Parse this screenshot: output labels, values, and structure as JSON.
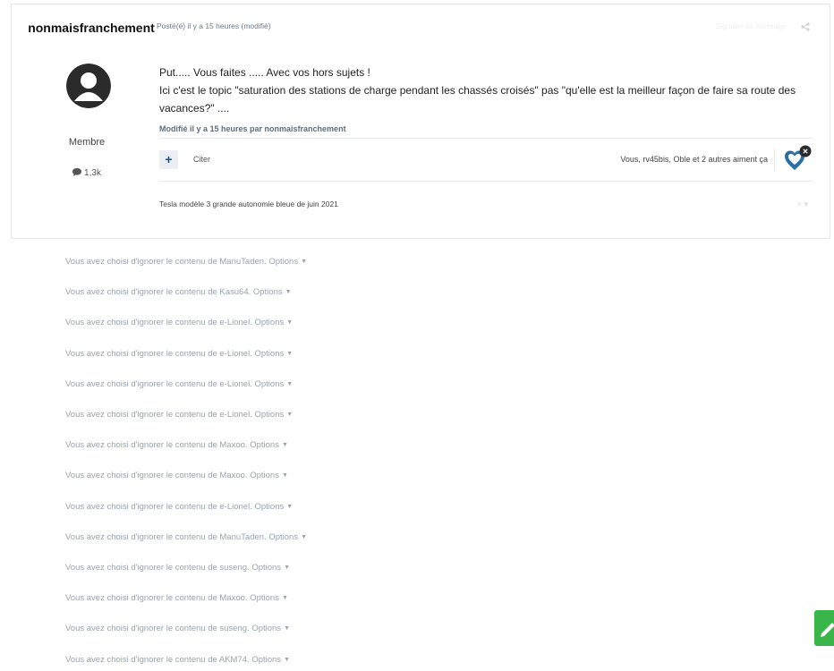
{
  "post": {
    "author_name": "nonmaisfranchement",
    "author_role": "Membre",
    "post_count": "1,3k",
    "meta": "Posté(é) il y a 15 heures (modifié)",
    "report_label": "Signaler ce message",
    "content": [
      "Put..... Vous faites ..... Avec vos hors sujets !",
      "Ici c'est le topic \"saturation des stations de charge pendant les chassés croisés\" pas \"qu'elle est la meilleur façon de faire sa route des vacances?\" ...."
    ],
    "edited_note": "Modifié il y a 15 heures par nonmaisfranchement",
    "quote_label": "Citer",
    "plus_label": "+",
    "likers": "Vous, rv45bis, Oble et 2 autres aiment ça",
    "signature": "Tesla modèle 3 grande autonomie bleue de juin 2021",
    "signature_ctrl": "× ▾"
  },
  "ignored": [
    {
      "text": "Vous avez choisi d'ignorer le contenu de ManuTaden.",
      "options": "Options"
    },
    {
      "text": "Vous avez choisi d'ignorer le contenu de Kasu64.",
      "options": "Options"
    },
    {
      "text": "Vous avez choisi d'ignorer le contenu de e-Lionel.",
      "options": "Options"
    },
    {
      "text": "Vous avez choisi d'ignorer le contenu de e-Lionel.",
      "options": "Options"
    },
    {
      "text": "Vous avez choisi d'ignorer le contenu de e-Lionel.",
      "options": "Options"
    },
    {
      "text": "Vous avez choisi d'ignorer le contenu de e-Lionel.",
      "options": "Options"
    },
    {
      "text": "Vous avez choisi d'ignorer le contenu de Maxoo.",
      "options": "Options"
    },
    {
      "text": "Vous avez choisi d'ignorer le contenu de Maxoo.",
      "options": "Options"
    },
    {
      "text": "Vous avez choisi d'ignorer le contenu de e-Lionel.",
      "options": "Options"
    },
    {
      "text": "Vous avez choisi d'ignorer le contenu de ManuTaden.",
      "options": "Options"
    },
    {
      "text": "Vous avez choisi d'ignorer le contenu de suseng.",
      "options": "Options"
    },
    {
      "text": "Vous avez choisi d'ignorer le contenu de Maxoo.",
      "options": "Options"
    },
    {
      "text": "Vous avez choisi d'ignorer le contenu de suseng.",
      "options": "Options"
    },
    {
      "text": "Vous avez choisi d'ignorer le contenu de AKM74.",
      "options": "Options"
    }
  ],
  "colors": {
    "accent": "#1f4f8a",
    "reaction_heart": "#2c6fa8",
    "fab": "#39b54a"
  }
}
